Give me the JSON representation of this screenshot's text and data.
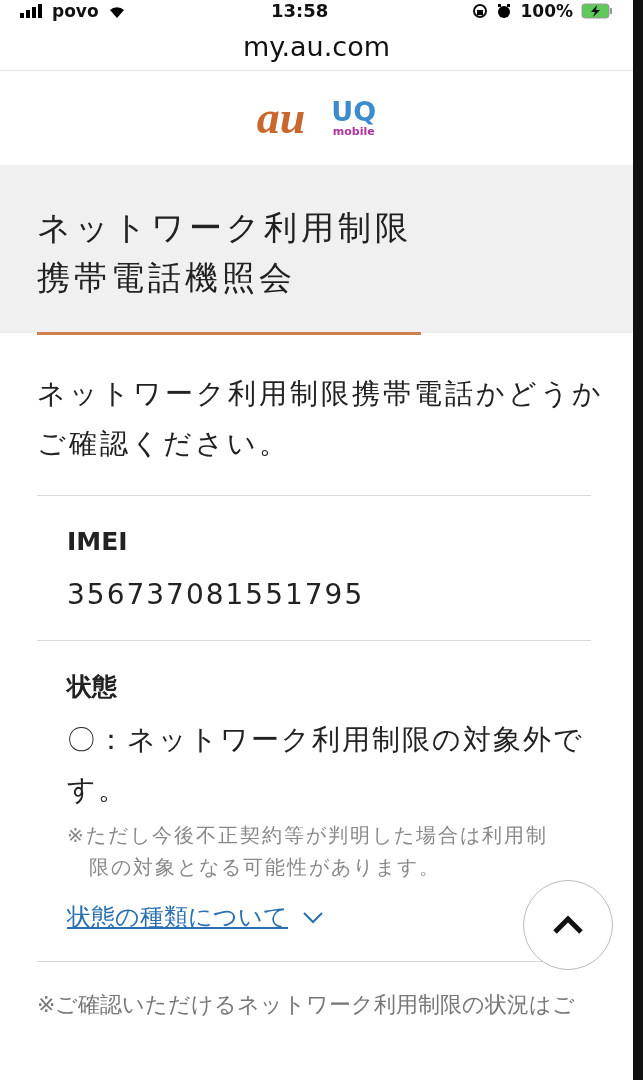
{
  "status_bar": {
    "carrier": "povo",
    "time": "13:58",
    "battery": "100%"
  },
  "address_bar": {
    "url": "my.au.com"
  },
  "logos": [
    {
      "kind": "au",
      "text": "au"
    },
    {
      "kind": "uq",
      "text": "UQ",
      "sub": "mobile"
    }
  ],
  "title": {
    "lines": [
      "ネットワーク利用制限",
      "携帯電話機照会"
    ]
  },
  "intro": "ネットワーク利用制限携帯電話かどうかご確認ください。",
  "fields": [
    {
      "label": "IMEI",
      "value": "356737081551795"
    },
    {
      "label": "状態",
      "value": "〇：ネットワーク利用制限の対象外です。",
      "note": "※ただし今後不正契約等が判明した場合は利用制限の対象となる可能性があります。",
      "link": "状態の種類について",
      "expanded": false
    }
  ],
  "footer_note": "※ご確認いただけるネットワーク利用制限の状況はご"
}
